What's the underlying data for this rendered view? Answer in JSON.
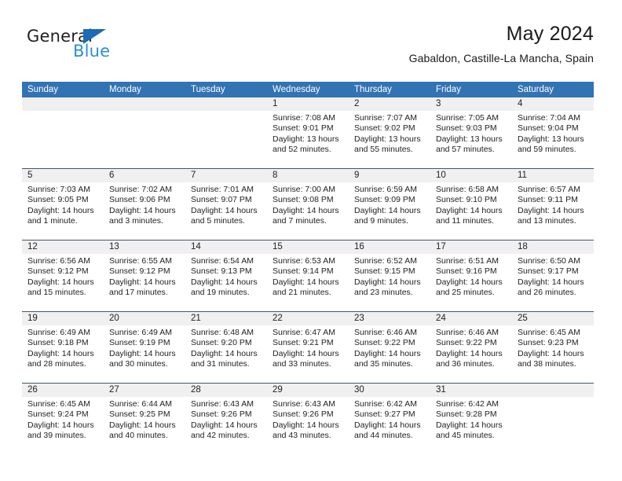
{
  "logo": {
    "word1": "General",
    "word2": "Blue",
    "triangle_color": "#1b6cb5",
    "word2_color": "#2c8fd6"
  },
  "header": {
    "title": "May 2024",
    "subtitle": "Gabaldon, Castille-La Mancha, Spain"
  },
  "theme": {
    "header_bg": "#3273b4",
    "day_band_bg": "#f0f0f0",
    "row_divider": "#43566b"
  },
  "weekdays": [
    "Sunday",
    "Monday",
    "Tuesday",
    "Wednesday",
    "Thursday",
    "Friday",
    "Saturday"
  ],
  "weeks": [
    [
      {
        "day": "",
        "sunrise": "",
        "sunset": "",
        "daylight_line1": "",
        "daylight_line2": ""
      },
      {
        "day": "",
        "sunrise": "",
        "sunset": "",
        "daylight_line1": "",
        "daylight_line2": ""
      },
      {
        "day": "",
        "sunrise": "",
        "sunset": "",
        "daylight_line1": "",
        "daylight_line2": ""
      },
      {
        "day": "1",
        "sunrise": "Sunrise: 7:08 AM",
        "sunset": "Sunset: 9:01 PM",
        "daylight_line1": "Daylight: 13 hours",
        "daylight_line2": "and 52 minutes."
      },
      {
        "day": "2",
        "sunrise": "Sunrise: 7:07 AM",
        "sunset": "Sunset: 9:02 PM",
        "daylight_line1": "Daylight: 13 hours",
        "daylight_line2": "and 55 minutes."
      },
      {
        "day": "3",
        "sunrise": "Sunrise: 7:05 AM",
        "sunset": "Sunset: 9:03 PM",
        "daylight_line1": "Daylight: 13 hours",
        "daylight_line2": "and 57 minutes."
      },
      {
        "day": "4",
        "sunrise": "Sunrise: 7:04 AM",
        "sunset": "Sunset: 9:04 PM",
        "daylight_line1": "Daylight: 13 hours",
        "daylight_line2": "and 59 minutes."
      }
    ],
    [
      {
        "day": "5",
        "sunrise": "Sunrise: 7:03 AM",
        "sunset": "Sunset: 9:05 PM",
        "daylight_line1": "Daylight: 14 hours",
        "daylight_line2": "and 1 minute."
      },
      {
        "day": "6",
        "sunrise": "Sunrise: 7:02 AM",
        "sunset": "Sunset: 9:06 PM",
        "daylight_line1": "Daylight: 14 hours",
        "daylight_line2": "and 3 minutes."
      },
      {
        "day": "7",
        "sunrise": "Sunrise: 7:01 AM",
        "sunset": "Sunset: 9:07 PM",
        "daylight_line1": "Daylight: 14 hours",
        "daylight_line2": "and 5 minutes."
      },
      {
        "day": "8",
        "sunrise": "Sunrise: 7:00 AM",
        "sunset": "Sunset: 9:08 PM",
        "daylight_line1": "Daylight: 14 hours",
        "daylight_line2": "and 7 minutes."
      },
      {
        "day": "9",
        "sunrise": "Sunrise: 6:59 AM",
        "sunset": "Sunset: 9:09 PM",
        "daylight_line1": "Daylight: 14 hours",
        "daylight_line2": "and 9 minutes."
      },
      {
        "day": "10",
        "sunrise": "Sunrise: 6:58 AM",
        "sunset": "Sunset: 9:10 PM",
        "daylight_line1": "Daylight: 14 hours",
        "daylight_line2": "and 11 minutes."
      },
      {
        "day": "11",
        "sunrise": "Sunrise: 6:57 AM",
        "sunset": "Sunset: 9:11 PM",
        "daylight_line1": "Daylight: 14 hours",
        "daylight_line2": "and 13 minutes."
      }
    ],
    [
      {
        "day": "12",
        "sunrise": "Sunrise: 6:56 AM",
        "sunset": "Sunset: 9:12 PM",
        "daylight_line1": "Daylight: 14 hours",
        "daylight_line2": "and 15 minutes."
      },
      {
        "day": "13",
        "sunrise": "Sunrise: 6:55 AM",
        "sunset": "Sunset: 9:12 PM",
        "daylight_line1": "Daylight: 14 hours",
        "daylight_line2": "and 17 minutes."
      },
      {
        "day": "14",
        "sunrise": "Sunrise: 6:54 AM",
        "sunset": "Sunset: 9:13 PM",
        "daylight_line1": "Daylight: 14 hours",
        "daylight_line2": "and 19 minutes."
      },
      {
        "day": "15",
        "sunrise": "Sunrise: 6:53 AM",
        "sunset": "Sunset: 9:14 PM",
        "daylight_line1": "Daylight: 14 hours",
        "daylight_line2": "and 21 minutes."
      },
      {
        "day": "16",
        "sunrise": "Sunrise: 6:52 AM",
        "sunset": "Sunset: 9:15 PM",
        "daylight_line1": "Daylight: 14 hours",
        "daylight_line2": "and 23 minutes."
      },
      {
        "day": "17",
        "sunrise": "Sunrise: 6:51 AM",
        "sunset": "Sunset: 9:16 PM",
        "daylight_line1": "Daylight: 14 hours",
        "daylight_line2": "and 25 minutes."
      },
      {
        "day": "18",
        "sunrise": "Sunrise: 6:50 AM",
        "sunset": "Sunset: 9:17 PM",
        "daylight_line1": "Daylight: 14 hours",
        "daylight_line2": "and 26 minutes."
      }
    ],
    [
      {
        "day": "19",
        "sunrise": "Sunrise: 6:49 AM",
        "sunset": "Sunset: 9:18 PM",
        "daylight_line1": "Daylight: 14 hours",
        "daylight_line2": "and 28 minutes."
      },
      {
        "day": "20",
        "sunrise": "Sunrise: 6:49 AM",
        "sunset": "Sunset: 9:19 PM",
        "daylight_line1": "Daylight: 14 hours",
        "daylight_line2": "and 30 minutes."
      },
      {
        "day": "21",
        "sunrise": "Sunrise: 6:48 AM",
        "sunset": "Sunset: 9:20 PM",
        "daylight_line1": "Daylight: 14 hours",
        "daylight_line2": "and 31 minutes."
      },
      {
        "day": "22",
        "sunrise": "Sunrise: 6:47 AM",
        "sunset": "Sunset: 9:21 PM",
        "daylight_line1": "Daylight: 14 hours",
        "daylight_line2": "and 33 minutes."
      },
      {
        "day": "23",
        "sunrise": "Sunrise: 6:46 AM",
        "sunset": "Sunset: 9:22 PM",
        "daylight_line1": "Daylight: 14 hours",
        "daylight_line2": "and 35 minutes."
      },
      {
        "day": "24",
        "sunrise": "Sunrise: 6:46 AM",
        "sunset": "Sunset: 9:22 PM",
        "daylight_line1": "Daylight: 14 hours",
        "daylight_line2": "and 36 minutes."
      },
      {
        "day": "25",
        "sunrise": "Sunrise: 6:45 AM",
        "sunset": "Sunset: 9:23 PM",
        "daylight_line1": "Daylight: 14 hours",
        "daylight_line2": "and 38 minutes."
      }
    ],
    [
      {
        "day": "26",
        "sunrise": "Sunrise: 6:45 AM",
        "sunset": "Sunset: 9:24 PM",
        "daylight_line1": "Daylight: 14 hours",
        "daylight_line2": "and 39 minutes."
      },
      {
        "day": "27",
        "sunrise": "Sunrise: 6:44 AM",
        "sunset": "Sunset: 9:25 PM",
        "daylight_line1": "Daylight: 14 hours",
        "daylight_line2": "and 40 minutes."
      },
      {
        "day": "28",
        "sunrise": "Sunrise: 6:43 AM",
        "sunset": "Sunset: 9:26 PM",
        "daylight_line1": "Daylight: 14 hours",
        "daylight_line2": "and 42 minutes."
      },
      {
        "day": "29",
        "sunrise": "Sunrise: 6:43 AM",
        "sunset": "Sunset: 9:26 PM",
        "daylight_line1": "Daylight: 14 hours",
        "daylight_line2": "and 43 minutes."
      },
      {
        "day": "30",
        "sunrise": "Sunrise: 6:42 AM",
        "sunset": "Sunset: 9:27 PM",
        "daylight_line1": "Daylight: 14 hours",
        "daylight_line2": "and 44 minutes."
      },
      {
        "day": "31",
        "sunrise": "Sunrise: 6:42 AM",
        "sunset": "Sunset: 9:28 PM",
        "daylight_line1": "Daylight: 14 hours",
        "daylight_line2": "and 45 minutes."
      },
      {
        "day": "",
        "sunrise": "",
        "sunset": "",
        "daylight_line1": "",
        "daylight_line2": ""
      }
    ]
  ]
}
